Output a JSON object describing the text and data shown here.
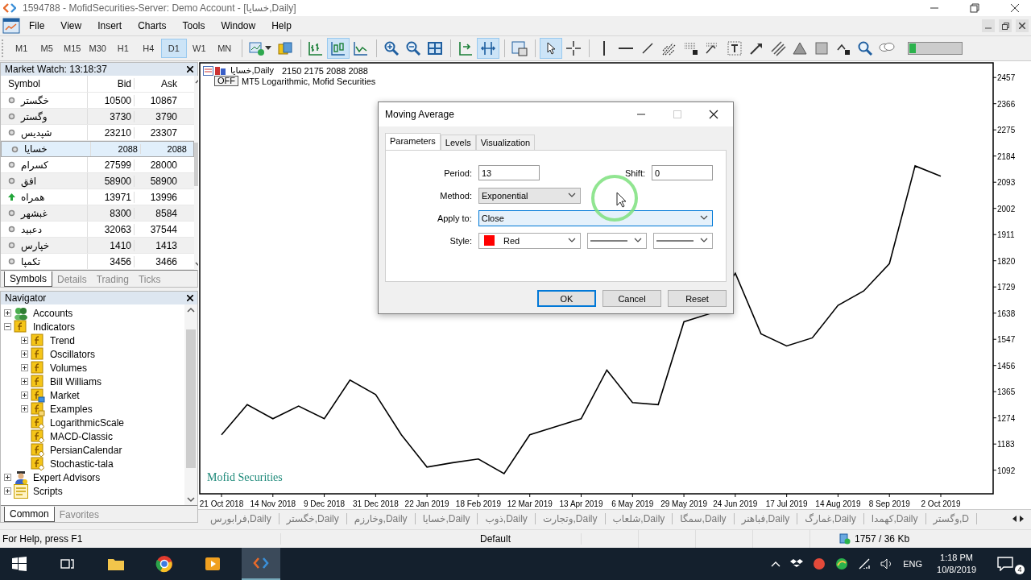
{
  "window": {
    "title": "1594788 - MofidSecurities-Server: Demo Account - [خسایا,Daily]"
  },
  "menu": [
    "File",
    "View",
    "Insert",
    "Charts",
    "Tools",
    "Window",
    "Help"
  ],
  "toolbar": {
    "timeframes": [
      {
        "label": "M1",
        "selected": false
      },
      {
        "label": "M5",
        "selected": false
      },
      {
        "label": "M15",
        "selected": false
      },
      {
        "label": "M30",
        "selected": false
      },
      {
        "label": "H1",
        "selected": false
      },
      {
        "label": "H4",
        "selected": false
      },
      {
        "label": "D1",
        "selected": true
      },
      {
        "label": "W1",
        "selected": false
      },
      {
        "label": "MN",
        "selected": false
      }
    ],
    "tools": [
      {
        "kind": "new-chart",
        "selected": false
      },
      {
        "kind": "coins",
        "selected": false
      },
      {
        "kind": "sep"
      },
      {
        "kind": "bars",
        "selected": false
      },
      {
        "kind": "candles",
        "selected": true
      },
      {
        "kind": "line",
        "selected": false
      },
      {
        "kind": "sep"
      },
      {
        "kind": "zoom-in",
        "selected": false
      },
      {
        "kind": "zoom-out",
        "selected": false
      },
      {
        "kind": "tile",
        "selected": false
      },
      {
        "kind": "sep"
      },
      {
        "kind": "shift",
        "selected": false
      },
      {
        "kind": "autoscroll",
        "selected": true
      },
      {
        "kind": "sep"
      },
      {
        "kind": "template",
        "selected": false
      },
      {
        "kind": "sep"
      },
      {
        "kind": "cursor",
        "selected": true
      },
      {
        "kind": "crosshair",
        "selected": false
      },
      {
        "kind": "sep"
      },
      {
        "kind": "vline",
        "selected": false
      },
      {
        "kind": "hline",
        "selected": false
      },
      {
        "kind": "trend",
        "selected": false
      },
      {
        "kind": "fan",
        "selected": false
      },
      {
        "kind": "grid",
        "selected": false
      },
      {
        "kind": "fibo",
        "selected": false
      },
      {
        "kind": "text",
        "selected": false
      },
      {
        "kind": "arrow",
        "selected": false
      },
      {
        "kind": "channel",
        "selected": false
      },
      {
        "kind": "triangle",
        "selected": false
      },
      {
        "kind": "rectangle",
        "selected": false
      },
      {
        "kind": "wave",
        "selected": false
      },
      {
        "kind": "search",
        "selected": false
      },
      {
        "kind": "chat",
        "selected": false
      }
    ]
  },
  "market_watch": {
    "title": "Market Watch: 13:18:37",
    "columns": [
      "Symbol",
      "Bid",
      "Ask"
    ],
    "rows": [
      {
        "symbol": "خگستر",
        "bid": "10500",
        "ask": "10867",
        "kind": "flat",
        "selected": false
      },
      {
        "symbol": "وگستر",
        "bid": "3730",
        "ask": "3790",
        "kind": "flat",
        "selected": false
      },
      {
        "symbol": "شپدیس",
        "bid": "23210",
        "ask": "23307",
        "kind": "flat",
        "selected": false
      },
      {
        "symbol": "خسایا",
        "bid": "2088",
        "ask": "2088",
        "kind": "flat",
        "selected": true
      },
      {
        "symbol": "کسرام",
        "bid": "27599",
        "ask": "28000",
        "kind": "flat",
        "selected": false
      },
      {
        "symbol": "افق",
        "bid": "58900",
        "ask": "58900",
        "kind": "flat",
        "selected": false
      },
      {
        "symbol": "همراه",
        "bid": "13971",
        "ask": "13996",
        "kind": "up",
        "selected": false
      },
      {
        "symbol": "غبشهر",
        "bid": "8300",
        "ask": "8584",
        "kind": "flat",
        "selected": false
      },
      {
        "symbol": "دعبید",
        "bid": "32063",
        "ask": "37544",
        "kind": "flat",
        "selected": false
      },
      {
        "symbol": "خپارس",
        "bid": "1410",
        "ask": "1413",
        "kind": "flat",
        "selected": false
      },
      {
        "symbol": "تکمپا",
        "bid": "3456",
        "ask": "3466",
        "kind": "flat",
        "selected": false
      }
    ],
    "tabs": [
      {
        "label": "Symbols",
        "selected": true
      },
      {
        "label": "Details",
        "selected": false
      },
      {
        "label": "Trading",
        "selected": false
      },
      {
        "label": "Ticks",
        "selected": false
      }
    ]
  },
  "navigator": {
    "title": "Navigator",
    "tree": [
      {
        "label": "Accounts",
        "kind": "accounts",
        "expanded": false
      },
      {
        "label": "Indicators",
        "kind": "folder",
        "expanded": true,
        "children": [
          {
            "label": "Trend",
            "kind": "folder",
            "expanded": false
          },
          {
            "label": "Oscillators",
            "kind": "folder",
            "expanded": false
          },
          {
            "label": "Volumes",
            "kind": "folder",
            "expanded": false
          },
          {
            "label": "Bill Williams",
            "kind": "folder",
            "expanded": false
          },
          {
            "label": "Market",
            "kind": "market",
            "expanded": false
          },
          {
            "label": "Examples",
            "kind": "examples",
            "expanded": false
          },
          {
            "label": "LogarithmicScale",
            "kind": "indicator"
          },
          {
            "label": "MACD-Classic",
            "kind": "indicator"
          },
          {
            "label": "PersianCalendar",
            "kind": "indicator"
          },
          {
            "label": "Stochastic-tala",
            "kind": "indicator"
          }
        ]
      },
      {
        "label": "Expert Advisors",
        "kind": "experts",
        "expanded": false
      },
      {
        "label": "Scripts",
        "kind": "scripts",
        "expanded": false
      }
    ],
    "tabs": [
      {
        "label": "Common",
        "selected": true
      },
      {
        "label": "Favorites",
        "selected": false
      }
    ]
  },
  "chart": {
    "symbol": "خسایا,Daily",
    "ohlc": "2150 2175 2088 2088",
    "badge": "OFF",
    "indicator": "MT5 Logarithmic, Mofid Securities",
    "brand": "Mofid Securities",
    "chart_data": {
      "type": "line",
      "ylim": [
        1010,
        2508
      ],
      "categories": [
        "21 Oct 2018",
        null,
        "14 Nov 2018",
        null,
        "9 Dec 2018",
        null,
        "31 Dec 2018",
        null,
        "22 Jan 2019",
        null,
        "18 Feb 2019",
        null,
        "12 Mar 2019",
        null,
        "13 Apr 2019",
        null,
        "6 May 2019",
        null,
        "29 May 2019",
        null,
        "24 Jun 2019",
        null,
        "17 Jul 2019",
        null,
        "14 Aug 2019",
        null,
        "8 Sep 2019",
        null,
        "2 Oct 2019"
      ],
      "series": [
        {
          "color": "#000000",
          "values": [
            1215,
            1320,
            1271,
            1315,
            1271,
            1405,
            1355,
            1215,
            1103,
            1118,
            1131,
            1080,
            1215,
            1243,
            1271,
            1440,
            1327,
            1320,
            1608,
            1636,
            1777,
            1566,
            1524,
            1552,
            1665,
            1715,
            1810,
            2150,
            2114
          ]
        }
      ],
      "yticks": [
        2457,
        2366,
        2275,
        2184,
        2093,
        2002,
        1911,
        1820,
        1729,
        1638,
        1547,
        1456,
        1365,
        1274,
        1183,
        1092
      ]
    }
  },
  "chart_tabs": [
    "فرابورس,Daily",
    "خگستر,Daily",
    "وخارزم,Daily",
    "خسایا,Daily",
    "ذوب,Daily",
    "وتجارت,Daily",
    "شلعاب,Daily",
    "سمگا,Daily",
    "فباهنر,Daily",
    "غمارگ,Daily",
    "کهمدا,Daily",
    "وگستر,D"
  ],
  "dialog": {
    "title": "Moving Average",
    "tabs": [
      {
        "label": "Parameters",
        "selected": true
      },
      {
        "label": "Levels",
        "selected": false
      },
      {
        "label": "Visualization",
        "selected": false
      }
    ],
    "period": {
      "label": "Period:",
      "value": "13"
    },
    "shift": {
      "label": "Shift:",
      "value": "0"
    },
    "method": {
      "label": "Method:",
      "value": "Exponential"
    },
    "apply_to": {
      "label": "Apply to:",
      "value": "Close",
      "focused": true
    },
    "style": {
      "label": "Style:",
      "color_name": "Red",
      "color": "#ff0000"
    },
    "buttons": [
      {
        "label": "OK",
        "default": true
      },
      {
        "label": "Cancel",
        "default": false
      },
      {
        "label": "Reset",
        "default": false
      }
    ]
  },
  "status_bar": {
    "help": "For Help, press F1",
    "profile": "Default",
    "traffic": "1757 / 36 Kb"
  },
  "taskbar": {
    "language": "ENG",
    "time": "1:18 PM",
    "date": "10/8/2019",
    "notifications": "4"
  }
}
